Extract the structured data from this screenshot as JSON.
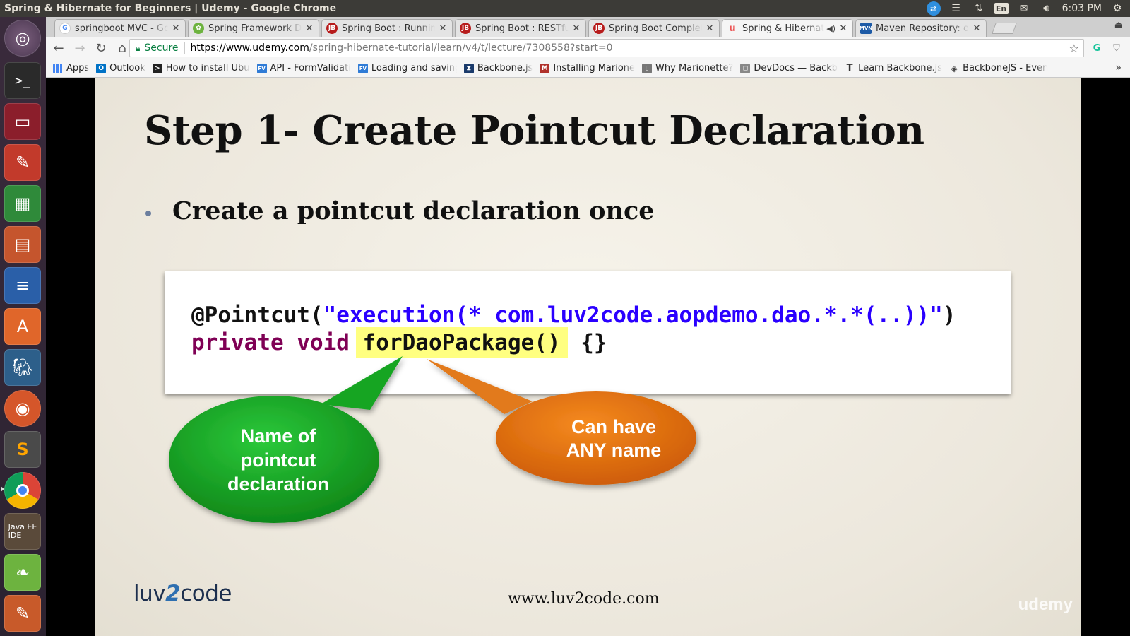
{
  "window": {
    "title": "Spring & Hibernate for Beginners | Udemy - Google Chrome",
    "clock": "6:03 PM",
    "lang": "En"
  },
  "tabs": [
    {
      "label": "springboot MVC - Go",
      "favicon": "google-icon",
      "color": "#4285f4"
    },
    {
      "label": "Spring Framework Do",
      "favicon": "spring-icon",
      "color": "#6db33f"
    },
    {
      "label": "Spring Boot : Running",
      "favicon": "javabrains-icon",
      "color": "#b71c1c"
    },
    {
      "label": "Spring Boot : RESTful",
      "favicon": "javabrains-icon",
      "color": "#b71c1c"
    },
    {
      "label": "Spring Boot Complete",
      "favicon": "javabrains-icon",
      "color": "#b71c1c"
    },
    {
      "label": "Spring & Hibernate",
      "favicon": "udemy-icon",
      "color": "#ec5252",
      "active": true,
      "audio": true
    },
    {
      "label": "Maven Repository: o",
      "favicon": "maven-icon",
      "color": "#1c5aa6"
    }
  ],
  "address_bar": {
    "secure_label": "Secure",
    "url_host": "https://www.udemy.com",
    "url_path": "/spring-hibernate-tutorial/learn/v4/t/lecture/7308558?start=0"
  },
  "bookmarks": [
    {
      "label": "Apps",
      "icon": "apps-grid-icon",
      "color": "#4285f4"
    },
    {
      "label": "Outlook",
      "icon": "outlook-icon",
      "color": "#0072c6"
    },
    {
      "label": "How to install Ubu",
      "icon": "terminal-icon",
      "color": "#222"
    },
    {
      "label": "API - FormValidati",
      "icon": "formvalidation-icon",
      "color": "#2f7bd6"
    },
    {
      "label": "Loading and saving",
      "icon": "formvalidation-icon",
      "color": "#2f7bd6"
    },
    {
      "label": "Backbone.js",
      "icon": "backbone-icon",
      "color": "#1a3a6b"
    },
    {
      "label": "Installing Marione",
      "icon": "marionette-icon",
      "color": "#b0322c"
    },
    {
      "label": "Why Marionette?",
      "icon": "book-icon",
      "color": "#555"
    },
    {
      "label": "DevDocs — Backb",
      "icon": "devdocs-icon",
      "color": "#666"
    },
    {
      "label": "Learn Backbone.js",
      "icon": "text-icon",
      "color": "#444"
    },
    {
      "label": "BackboneJS - Even",
      "icon": "gem-icon",
      "color": "#444"
    }
  ],
  "slide": {
    "title": "Step 1- Create Pointcut Declaration",
    "bullet": "Create a pointcut declaration once",
    "code": {
      "line1_annotation": "@Pointcut(",
      "line1_string": "\"execution(* com.luv2code.aopdemo.dao.*.*(..))\"",
      "line1_close": ")",
      "line2_keywords": "private void ",
      "line2_method": "forDaoPackage()",
      "line2_body": " {}"
    },
    "green_bubble": "Name of pointcut declaration",
    "orange_bubble": "Can have ANY name",
    "logo_pre": "luv",
    "logo_two": "2",
    "logo_post": "code",
    "website": "www.luv2code.com",
    "watermark": "udemy"
  },
  "colors": {
    "green_bubble": "#13a01f",
    "orange_bubble": "#e8720c",
    "highlight": "#ffff80"
  }
}
